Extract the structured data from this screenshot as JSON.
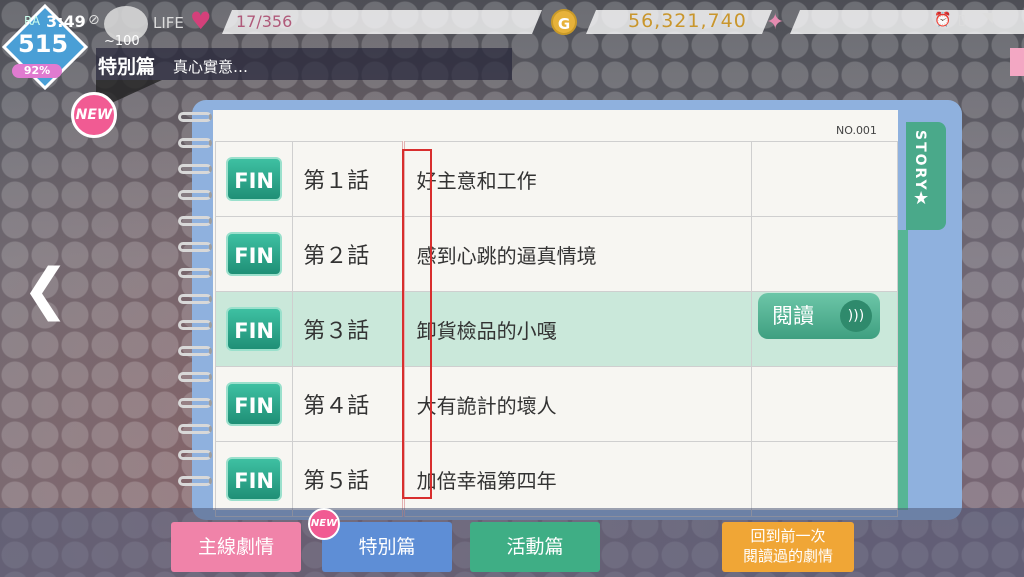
{
  "status": {
    "time": "3:49",
    "rank_label": "RA",
    "rank_value": "515",
    "rank_percent": "92%",
    "mascot_level": "~100",
    "life_label": "LIFE",
    "life_value": "17/356",
    "coin_icon_label": "G",
    "coin_value": "56,321,740"
  },
  "chapter": {
    "tag": "特別篇",
    "title": "真心實意…",
    "new_badge": "NEW"
  },
  "notebook": {
    "tab_label": "STORY",
    "number": "NO.001",
    "episodes": [
      {
        "badge": "FIN",
        "number": "第１話",
        "title": "好主意和工作"
      },
      {
        "badge": "FIN",
        "number": "第２話",
        "title": "感到心跳的逼真情境"
      },
      {
        "badge": "FIN",
        "number": "第３話",
        "title": "卸貨檢品的小嘎"
      },
      {
        "badge": "FIN",
        "number": "第４話",
        "title": "大有詭計的壞人"
      },
      {
        "badge": "FIN",
        "number": "第５話",
        "title": "加倍幸福第四年"
      }
    ],
    "read_button": "閱讀"
  },
  "bottom_tabs": {
    "main": "主線劇情",
    "special": "特別篇",
    "special_new": "NEW",
    "event": "活動篇",
    "resume_line1": "回到前一次",
    "resume_line2": "閱讀過的劇情"
  },
  "colors": {
    "accent_green": "#3fae85",
    "accent_pink": "#f083a9",
    "accent_blue": "#5e8ed6",
    "accent_orange": "#f0a636",
    "highlight_box": "#d82e2e"
  }
}
